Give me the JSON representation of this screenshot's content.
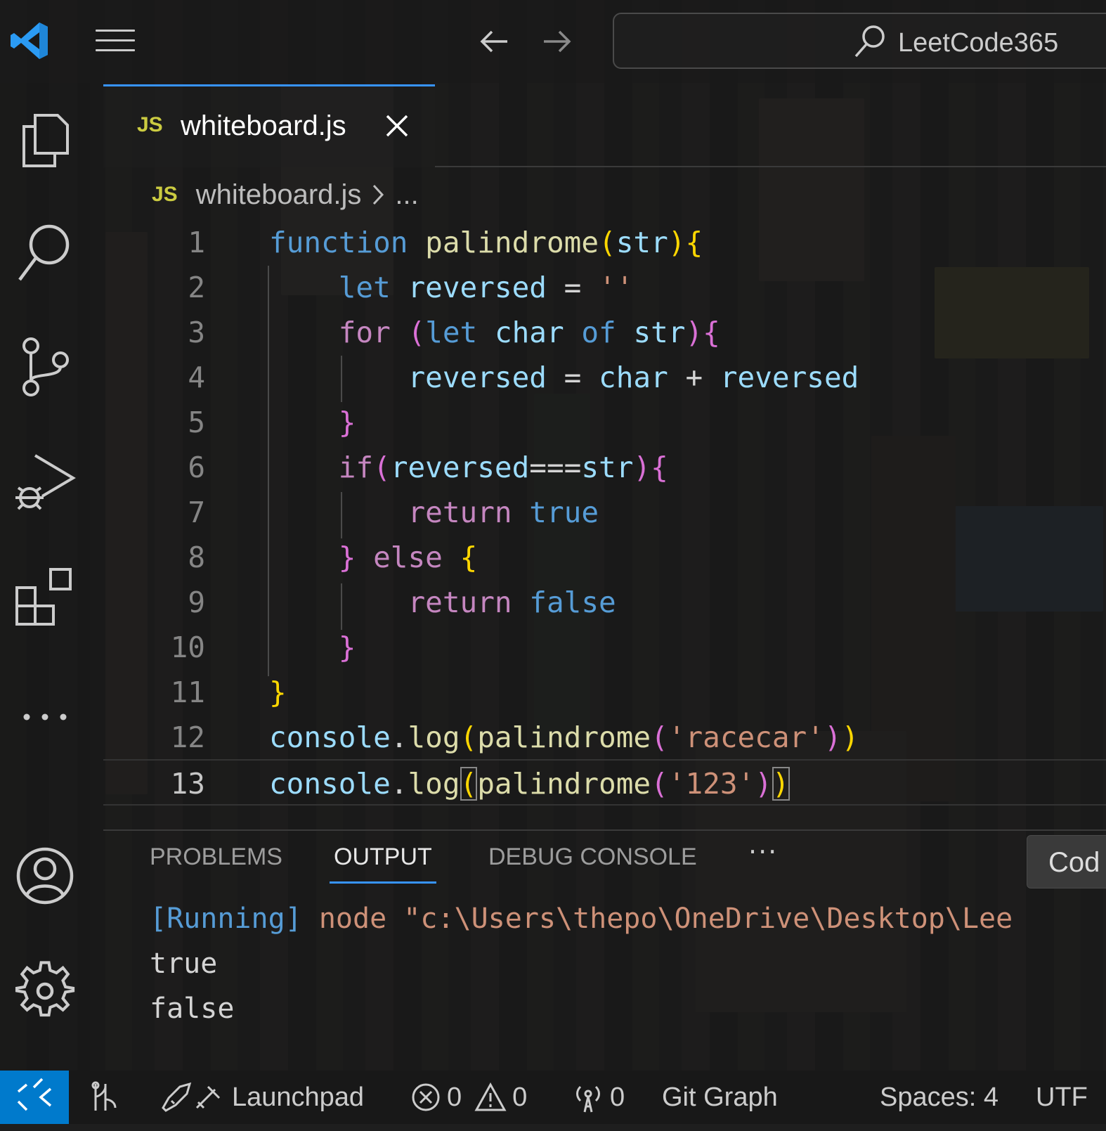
{
  "titlebar": {
    "search_text": "LeetCode365"
  },
  "tab": {
    "icon_text": "JS",
    "label": "whiteboard.js"
  },
  "breadcrumb": {
    "icon_text": "JS",
    "file": "whiteboard.js",
    "rest": "..."
  },
  "editor": {
    "line_numbers": [
      "1",
      "2",
      "3",
      "4",
      "5",
      "6",
      "7",
      "8",
      "9",
      "10",
      "11",
      "12",
      "13"
    ],
    "active_line": 13
  },
  "panel": {
    "tabs": [
      "PROBLEMS",
      "OUTPUT",
      "DEBUG CONSOLE"
    ],
    "active_tab": "OUTPUT",
    "more": "···",
    "button_label": "Cod",
    "output": {
      "running": "[Running]",
      "command": " node \"c:\\Users\\thepo\\OneDrive\\Desktop\\Lee",
      "lines": [
        "true",
        "false"
      ]
    }
  },
  "statusbar": {
    "launchpad": "Launchpad",
    "errors": "0",
    "warnings": "0",
    "ports": "0",
    "git_graph": "Git Graph",
    "spaces": "Spaces: 4",
    "encoding": "UTF"
  },
  "colors": {
    "accent": "#3794ff",
    "remote": "#007acc",
    "keyword_blue": "#569cd6",
    "keyword_purple": "#c586c0",
    "function": "#dcdcaa",
    "variable": "#9cdcfe",
    "string": "#ce9178"
  },
  "icons": [
    "vscode-logo-icon",
    "menu-icon",
    "arrow-left-icon",
    "arrow-right-icon",
    "search-icon",
    "files-icon",
    "search-icon",
    "source-control-icon",
    "run-debug-icon",
    "extensions-icon",
    "more-icon",
    "account-icon",
    "settings-gear-icon",
    "close-icon",
    "remote-icon",
    "launchpad-icon",
    "error-icon",
    "warning-icon",
    "ports-icon"
  ]
}
